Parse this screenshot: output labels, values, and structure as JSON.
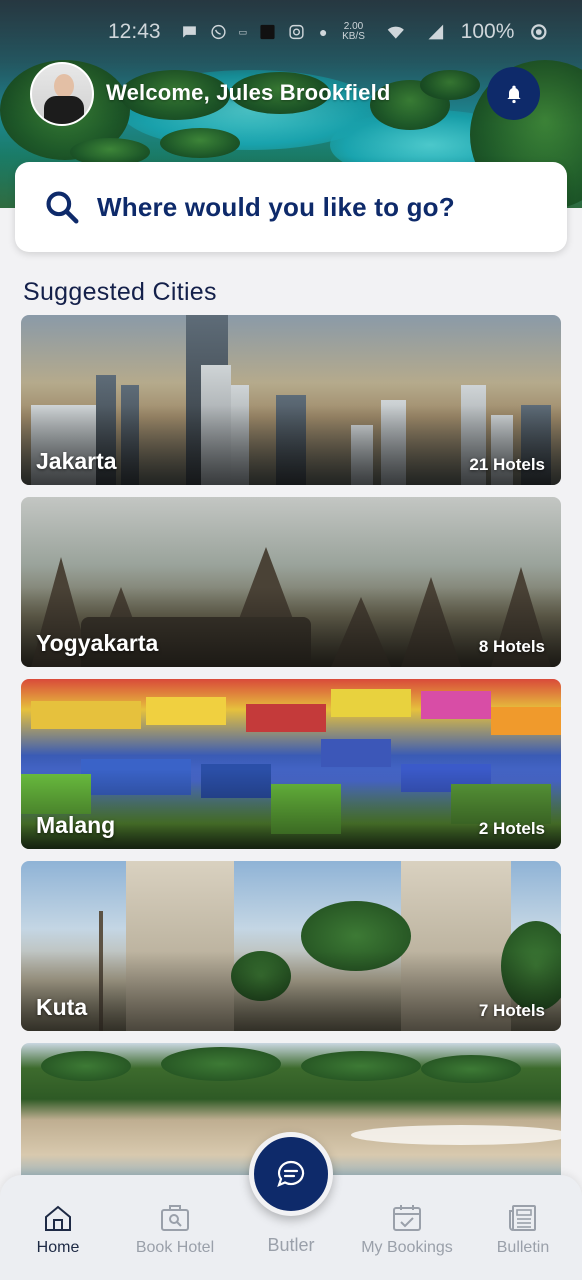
{
  "status_bar": {
    "time": "12:43",
    "net_speed": "2.00 KB/S",
    "battery": "100%"
  },
  "header": {
    "welcome_text": "Welcome, Jules Brookfield"
  },
  "search": {
    "placeholder": "Where would you like to go?"
  },
  "suggested": {
    "title": "Suggested Cities",
    "cities": [
      {
        "name": "Jakarta",
        "hotels": "21 Hotels"
      },
      {
        "name": "Yogyakarta",
        "hotels": "8 Hotels"
      },
      {
        "name": "Malang",
        "hotels": "2 Hotels"
      },
      {
        "name": "Kuta",
        "hotels": "7 Hotels"
      }
    ]
  },
  "nav": {
    "items": [
      {
        "label": "Home",
        "icon": "home-icon",
        "active": true
      },
      {
        "label": "Book Hotel",
        "icon": "hotel-icon",
        "active": false
      },
      {
        "label": "Butler",
        "icon": "chat-icon",
        "active": false
      },
      {
        "label": "My Bookings",
        "icon": "calendar-check-icon",
        "active": false
      },
      {
        "label": "Bulletin",
        "icon": "newspaper-icon",
        "active": false
      }
    ]
  },
  "colors": {
    "primary": "#0e2a6a",
    "nav_active": "#1e2a45",
    "nav_inactive": "#9aa0aa"
  }
}
